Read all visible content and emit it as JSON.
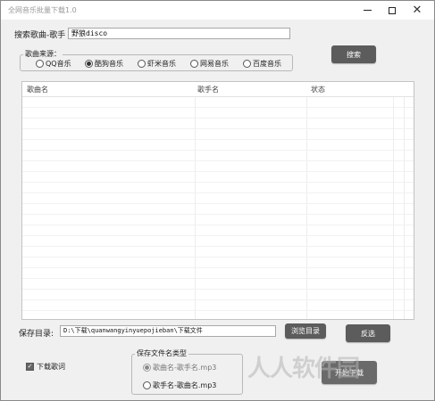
{
  "window": {
    "title": "全网音乐批量下载1.0"
  },
  "search": {
    "label": "搜索歌曲-歌手",
    "value": "野狼disco",
    "button": "搜索"
  },
  "source": {
    "legend": "歌曲来源：",
    "options": [
      {
        "label": "QQ音乐",
        "selected": false
      },
      {
        "label": "酷狗音乐",
        "selected": true
      },
      {
        "label": "虾米音乐",
        "selected": false
      },
      {
        "label": "网易音乐",
        "selected": false
      },
      {
        "label": "百度音乐",
        "selected": false
      }
    ]
  },
  "table": {
    "columns": [
      "歌曲名",
      "歌手名",
      "状态"
    ],
    "rows": []
  },
  "save": {
    "label": "保存目录:",
    "path": "D:\\下载\\quanwangyinyuepojieban\\下载文件",
    "browse_button": "浏览目录",
    "invert_button": "反选"
  },
  "options": {
    "download_lyrics_label": "下载歌词",
    "download_lyrics_checked": true
  },
  "filename_type": {
    "legend": "保存文件名类型",
    "options": [
      {
        "label": "歌曲名-歌手名.mp3",
        "selected": true
      },
      {
        "label": "歌手名-歌曲名.mp3",
        "selected": false
      }
    ]
  },
  "download_button": "开始下载",
  "watermark": "人人软件园"
}
